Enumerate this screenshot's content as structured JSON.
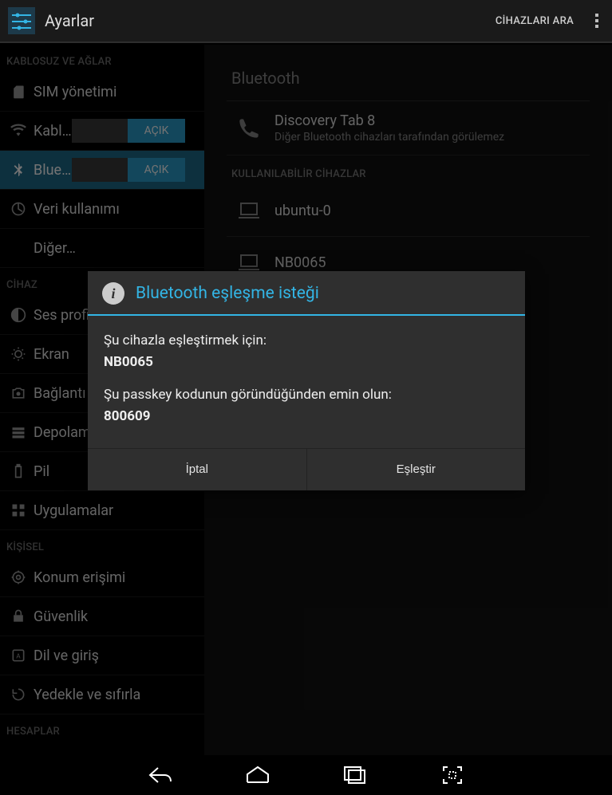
{
  "actionbar": {
    "title": "Ayarlar",
    "scan_action": "CİHAZLARI ARA"
  },
  "sidebar": {
    "sections": {
      "wireless_header": "KABLOSUZ VE AĞLAR",
      "device_header": "CİHAZ",
      "personal_header": "KİŞİSEL",
      "accounts_header": "HESAPLAR"
    },
    "items": {
      "sim": "SIM yönetimi",
      "wifi": "Kablosuz",
      "bluetooth": "Bluetooth",
      "data": "Veri kullanımı",
      "more": "Diğer…",
      "audio": "Ses profilleri",
      "display": "Ekran",
      "connect": "Bağlantı",
      "storage": "Depolama",
      "battery": "Pil",
      "apps": "Uygulamalar",
      "location": "Konum erişimi",
      "security": "Güvenlik",
      "lang": "Dil ve giriş",
      "backup": "Yedekle ve sıfırla"
    },
    "toggle_on_label": "AÇIK"
  },
  "main": {
    "heading": "Bluetooth",
    "this_device": {
      "name": "Discovery Tab 8",
      "sub": "Diğer Bluetooth cihazları tarafından görülemez"
    },
    "available_header": "KULLANILABİLİR CİHAZLAR",
    "devices": [
      {
        "name": "ubuntu-0"
      },
      {
        "name": "NB0065"
      }
    ]
  },
  "dialog": {
    "title": "Bluetooth eşleşme isteği",
    "pair_with_label": "Şu cihazla eşleştirmek için:",
    "device_name": "NB0065",
    "passkey_label": "Şu passkey kodunun göründüğünden emin olun:",
    "passkey": "800609",
    "cancel": "İptal",
    "pair": "Eşleştir"
  }
}
